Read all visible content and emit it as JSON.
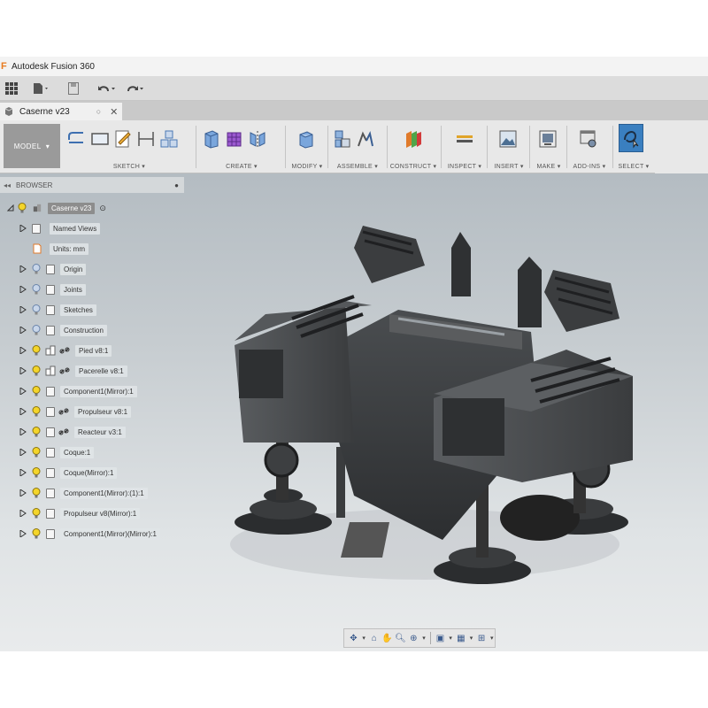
{
  "app": {
    "title": "Autodesk Fusion 360"
  },
  "quick_access": {
    "items": [
      "data-panel-icon",
      "file-icon",
      "save-icon",
      "undo-icon",
      "redo-icon"
    ]
  },
  "document_tab": {
    "name": "Caserne v23"
  },
  "ribbon": {
    "workspace_label": "MODEL",
    "groups": [
      {
        "label": "SKETCH"
      },
      {
        "label": "CREATE"
      },
      {
        "label": "MODIFY"
      },
      {
        "label": "ASSEMBLE"
      },
      {
        "label": "CONSTRUCT"
      },
      {
        "label": "INSPECT"
      },
      {
        "label": "INSERT"
      },
      {
        "label": "MAKE"
      },
      {
        "label": "ADD-INS"
      },
      {
        "label": "SELECT"
      }
    ]
  },
  "browser": {
    "header": "BROWSER",
    "items": [
      {
        "label": "Caserne v23",
        "type": "root"
      },
      {
        "label": "Named Views"
      },
      {
        "label": "Units: mm"
      },
      {
        "label": "Origin"
      },
      {
        "label": "Joints"
      },
      {
        "label": "Sketches"
      },
      {
        "label": "Construction"
      },
      {
        "label": "Pied v8:1"
      },
      {
        "label": "Pacerelle v8:1"
      },
      {
        "label": "Component1(Mirror):1"
      },
      {
        "label": "Propulseur v8:1"
      },
      {
        "label": "Reacteur v3:1"
      },
      {
        "label": "Coque:1"
      },
      {
        "label": "Coque(Mirror):1"
      },
      {
        "label": "Component1(Mirror):(1):1"
      },
      {
        "label": "Propulseur v8(Mirror):1"
      },
      {
        "label": "Component1(Mirror)(Mirror):1"
      }
    ]
  },
  "colors": {
    "accent_select": "#3a7fc0",
    "bulb_on": "#f4d52a",
    "bulb_off": "#8fa7c9"
  }
}
